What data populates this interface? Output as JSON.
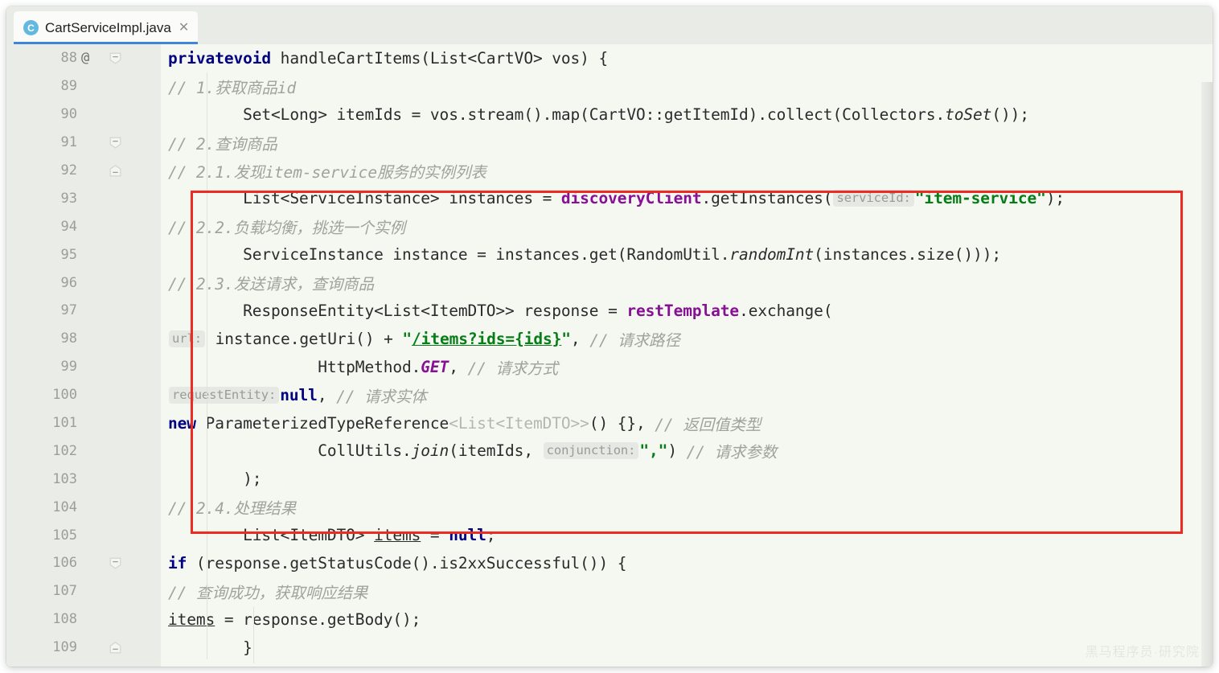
{
  "window": {
    "app": "IntelliJ IDEA editor",
    "watermark": "黑马程序员·研究院"
  },
  "tab": {
    "icon": "java-class-icon",
    "icon_letter": "C",
    "title": "CartServiceImpl.java",
    "close_label": "✕"
  },
  "gutter": {
    "annotation_marker": "@",
    "lines": [
      {
        "num": "88",
        "at": "@",
        "fold": "collapse-top"
      },
      {
        "num": "89",
        "at": "",
        "fold": ""
      },
      {
        "num": "90",
        "at": "",
        "fold": ""
      },
      {
        "num": "91",
        "at": "",
        "fold": "collapse-top"
      },
      {
        "num": "92",
        "at": "",
        "fold": "collapse-mid"
      },
      {
        "num": "93",
        "at": "",
        "fold": ""
      },
      {
        "num": "94",
        "at": "",
        "fold": ""
      },
      {
        "num": "95",
        "at": "",
        "fold": ""
      },
      {
        "num": "96",
        "at": "",
        "fold": ""
      },
      {
        "num": "97",
        "at": "",
        "fold": ""
      },
      {
        "num": "98",
        "at": "",
        "fold": ""
      },
      {
        "num": "99",
        "at": "",
        "fold": ""
      },
      {
        "num": "100",
        "at": "",
        "fold": ""
      },
      {
        "num": "101",
        "at": "",
        "fold": ""
      },
      {
        "num": "102",
        "at": "",
        "fold": ""
      },
      {
        "num": "103",
        "at": "",
        "fold": ""
      },
      {
        "num": "104",
        "at": "",
        "fold": ""
      },
      {
        "num": "105",
        "at": "",
        "fold": ""
      },
      {
        "num": "106",
        "at": "",
        "fold": "collapse-top"
      },
      {
        "num": "107",
        "at": "",
        "fold": ""
      },
      {
        "num": "108",
        "at": "",
        "fold": ""
      },
      {
        "num": "109",
        "at": "",
        "fold": "collapse-mid"
      }
    ]
  },
  "code": {
    "language": "java",
    "first_line": 88,
    "lines": [
      {
        "n": 88,
        "text": "    private void handleCartItems(List<CartVO> vos) {"
      },
      {
        "n": 89,
        "text": "        // 1.获取商品id"
      },
      {
        "n": 90,
        "text": "        Set<Long> itemIds = vos.stream().map(CartVO::getItemId).collect(Collectors.toSet());"
      },
      {
        "n": 91,
        "text": "        // 2.查询商品"
      },
      {
        "n": 92,
        "text": "        // 2.1.发现item-service服务的实例列表"
      },
      {
        "n": 93,
        "text": "        List<ServiceInstance> instances = discoveryClient.getInstances( serviceId: \"item-service\");"
      },
      {
        "n": 94,
        "text": "        // 2.2.负载均衡，挑选一个实例"
      },
      {
        "n": 95,
        "text": "        ServiceInstance instance = instances.get(RandomUtil.randomInt(instances.size()));"
      },
      {
        "n": 96,
        "text": "        // 2.3.发送请求，查询商品"
      },
      {
        "n": 97,
        "text": "        ResponseEntity<List<ItemDTO>> response = restTemplate.exchange("
      },
      {
        "n": 98,
        "text": "                url: instance.getUri() + \"/items?ids={ids}\", // 请求路径"
      },
      {
        "n": 99,
        "text": "                HttpMethod.GET, // 请求方式"
      },
      {
        "n": 100,
        "text": "                requestEntity: null, // 请求实体"
      },
      {
        "n": 101,
        "text": "                new ParameterizedTypeReference<List<ItemDTO>>() {}, // 返回值类型"
      },
      {
        "n": 102,
        "text": "                CollUtils.join(itemIds,  conjunction: \",\") // 请求参数"
      },
      {
        "n": 103,
        "text": "        );"
      },
      {
        "n": 104,
        "text": "        // 2.4.处理结果"
      },
      {
        "n": 105,
        "text": "        List<ItemDTO> items = null;"
      },
      {
        "n": 106,
        "text": "        if (response.getStatusCode().is2xxSuccessful()) {"
      },
      {
        "n": 107,
        "text": "            // 查询成功，获取响应结果"
      },
      {
        "n": 108,
        "text": "            items = response.getBody();"
      },
      {
        "n": 109,
        "text": "        }"
      }
    ],
    "inlay_hints": [
      "serviceId:",
      "url:",
      "requestEntity:",
      "conjunction:"
    ]
  },
  "annotation": {
    "type": "red-rectangle-highlight",
    "color": "#ee2b23",
    "covers_lines": "92-103"
  },
  "colors": {
    "keyword": "#000080",
    "comment": "#9fa39c",
    "string": "#067d17",
    "field": "#871094",
    "editor_bg": "#f4f8f1",
    "gutter_bg": "#e9ece7",
    "tab_accent": "#3f86d8",
    "highlight": "#ee2b23"
  }
}
